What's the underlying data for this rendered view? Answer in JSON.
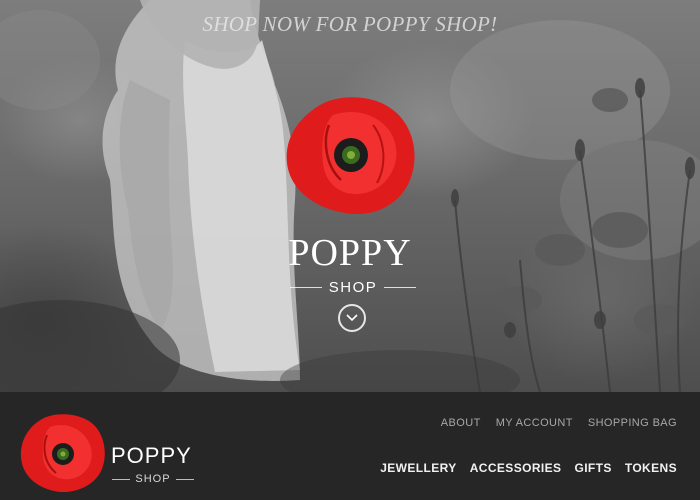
{
  "hero": {
    "tagline": "SHOP NOW FOR POPPY SHOP!",
    "logo_title": "POPPY",
    "logo_subtitle": "SHOP",
    "scroll_icon": "chevron-down-icon"
  },
  "header": {
    "brand_title": "POPPY",
    "brand_subtitle": "SHOP",
    "utility_nav": [
      "ABOUT",
      "MY ACCOUNT",
      "SHOPPING BAG"
    ],
    "main_nav": [
      "JEWELLERY",
      "ACCESSORIES",
      "GIFTS",
      "TOKENS"
    ]
  },
  "colors": {
    "poppy_red": "#e01b1b",
    "poppy_center": "#1f3a12",
    "nav_background": "#262626"
  }
}
